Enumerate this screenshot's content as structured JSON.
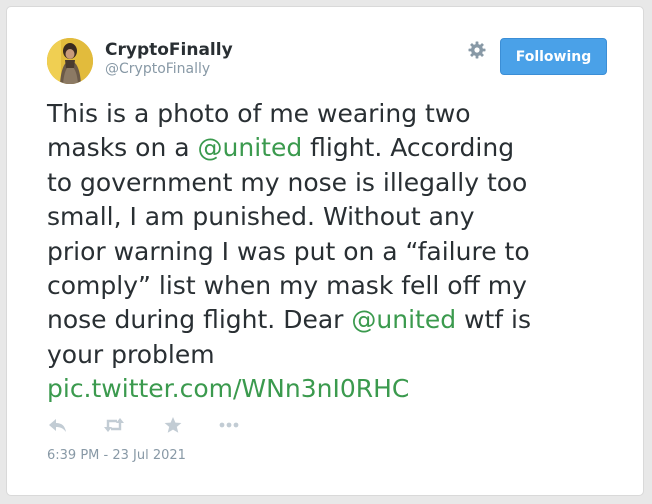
{
  "user": {
    "display_name": "CryptoFinally",
    "handle": "@CryptoFinally"
  },
  "header": {
    "settings_icon": "gear-icon",
    "follow_button_label": "Following"
  },
  "tweet": {
    "line1": "This is a photo of me wearing two",
    "line2_before": "masks on a ",
    "mention1": "@united",
    "line2_after": " flight. According",
    "line3": "to government my nose is illegally too",
    "line4": "small, I am punished. Without any",
    "line5": "prior warning I was put on a “failure to",
    "line6": "comply” list when my mask fell off my",
    "line7_before": "nose during flight. Dear ",
    "mention2": "@united",
    "line7_after": " wtf is",
    "line8": "your problem",
    "link": "pic.twitter.com/WNn3nI0RHC"
  },
  "actions": {
    "icons": [
      "reply-icon",
      "retweet-icon",
      "favorite-icon",
      "more-icon"
    ]
  },
  "timestamp": "6:39 PM - 23 Jul 2021",
  "colors": {
    "link_green": "#3b9a4e",
    "button_blue": "#4aa1e8",
    "muted_text": "#8899a6",
    "icon_gray": "#c2ccd4"
  }
}
